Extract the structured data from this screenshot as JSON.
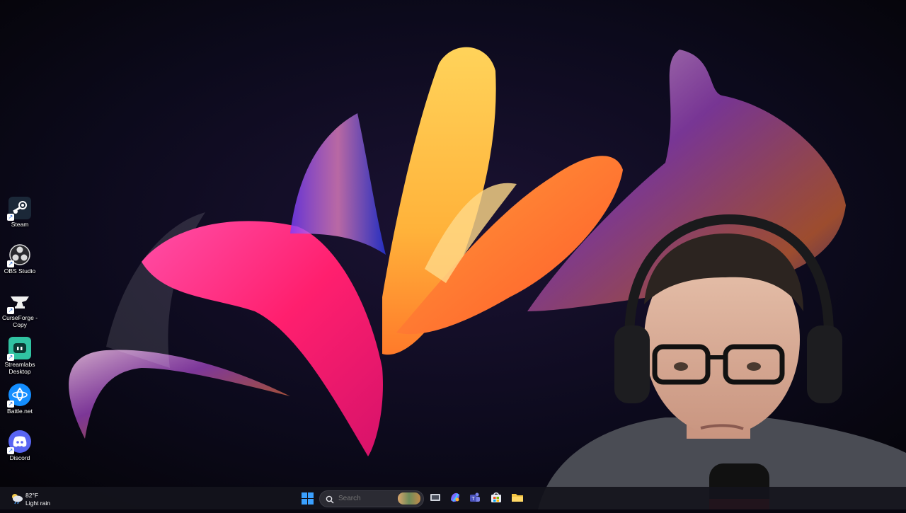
{
  "desktop": {
    "icons": [
      {
        "label": "Steam",
        "icon": "steam-icon"
      },
      {
        "label": "OBS Studio",
        "icon": "obs-icon"
      },
      {
        "label": "CurseForge - Copy",
        "icon": "curseforge-icon"
      },
      {
        "label": "Streamlabs Desktop",
        "icon": "streamlabs-icon"
      },
      {
        "label": "Battle.net",
        "icon": "battlenet-icon"
      },
      {
        "label": "Discord",
        "icon": "discord-icon"
      }
    ]
  },
  "taskbar": {
    "weather": {
      "temp": "82°F",
      "condition": "Light rain",
      "icon": "weather-icon"
    },
    "search": {
      "placeholder": "Search"
    },
    "apps": [
      "start-icon",
      "task-view-icon",
      "copilot-icon",
      "teams-icon",
      "store-icon",
      "file-explorer-icon"
    ]
  },
  "colors": {
    "steam": "#1b2838",
    "discord": "#5865f2",
    "streamlabs": "#31c3a2",
    "battlenet": "#148eff",
    "accent_start": "#3aa0ff"
  }
}
